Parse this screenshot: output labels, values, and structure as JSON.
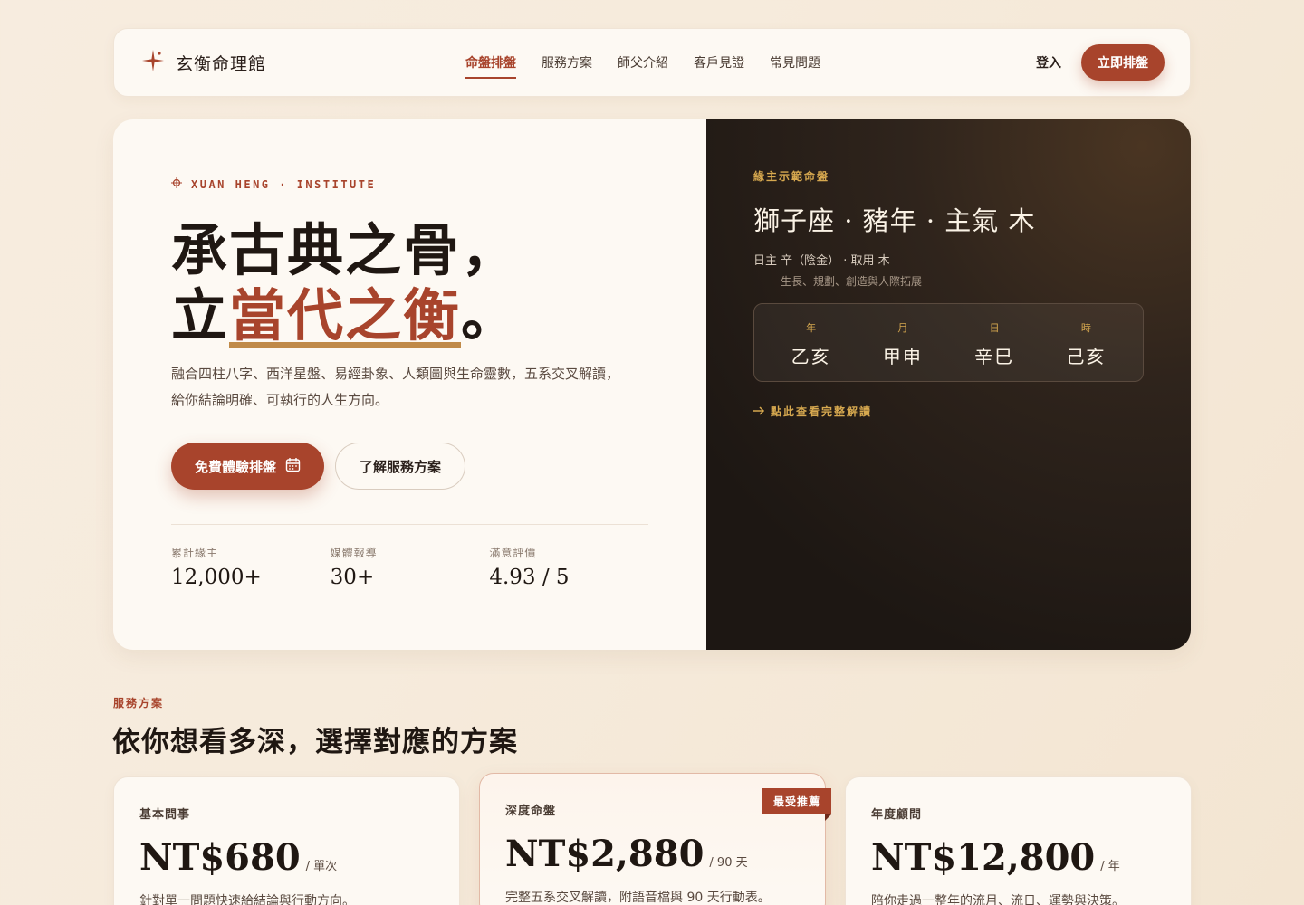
{
  "nav": {
    "brand": "玄衡命理館",
    "links": [
      "命盤排盤",
      "服務方案",
      "師父介紹",
      "客戶見證",
      "常見問題"
    ],
    "login": "登入",
    "cta": "立即排盤"
  },
  "hero": {
    "eyebrow": "XUAN HENG · INSTITUTE",
    "headline_line1": "承古典之骨，",
    "headline_line2_prefix": "立",
    "headline_accent": "當代之衡",
    "headline_line2_suffix": "。",
    "lead": "融合四柱八字、西洋星盤、易經卦象、人類圖與生命靈數，五系交叉解讀，給你結論明確、可執行的人生方向。",
    "primary_button": "免費體驗排盤",
    "secondary_button": "了解服務方案",
    "stats": [
      {
        "label": "累計緣主",
        "value": "12,000+"
      },
      {
        "label": "媒體報導",
        "value": "30+"
      },
      {
        "label": "滿意評價",
        "value": "4.93 / 5"
      }
    ]
  },
  "chart": {
    "tag": "緣主示範命盤",
    "title": "獅子座 · 豬年 · 主氣 木",
    "sub": "日主 辛（陰金） · 取用 木",
    "sub2": "生長、規劃、創造與人際拓展",
    "pillars": [
      {
        "label": "年",
        "value": "乙亥"
      },
      {
        "label": "月",
        "value": "甲申"
      },
      {
        "label": "日",
        "value": "辛巳"
      },
      {
        "label": "時",
        "value": "己亥"
      }
    ],
    "link": "點此查看完整解讀"
  },
  "services": {
    "eyebrow": "服務方案",
    "title": "依你想看多深，選擇對應的方案",
    "cards": [
      {
        "name": "基本問事",
        "price": "NT$680",
        "unit": "/ 單次",
        "desc": "針對單一問題快速給結論與行動方向。"
      },
      {
        "name": "深度命盤",
        "price": "NT$2,880",
        "unit": "/ 90 天",
        "desc": "完整五系交叉解讀，附語音檔與 90 天行動表。",
        "badge": "最受推薦"
      },
      {
        "name": "年度顧問",
        "price": "NT$12,800",
        "unit": "/ 年",
        "desc": "陪你走過一整年的流月、流日、運勢與決策。"
      }
    ]
  },
  "colors": {
    "accent": "#a8442c",
    "gold": "#d6a84f",
    "dark": "#1d1713"
  }
}
